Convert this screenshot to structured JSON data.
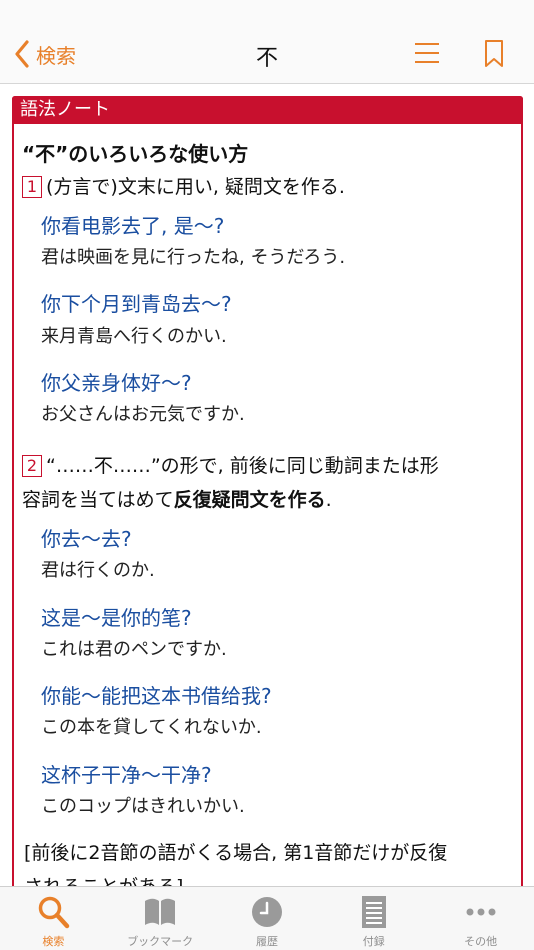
{
  "nav": {
    "back_label": "検索",
    "title": "不"
  },
  "note": {
    "header": "語法ノート",
    "heading": "“不”のいろいろな使い方",
    "section1": {
      "num": "1",
      "text": "(方言で)文末に用い, 疑問文を作る.",
      "examples": [
        {
          "zh": "你看电影去了, 是～?",
          "ja": "君は映画を見に行ったね, そうだろう."
        },
        {
          "zh": "你下个月到青岛去～?",
          "ja": "来月青島へ行くのかい."
        },
        {
          "zh": "你父亲身体好～?",
          "ja": "お父さんはお元気ですか."
        }
      ]
    },
    "section2": {
      "num": "2",
      "text_line1": "“……不……”の形で, 前後に同じ動詞または形",
      "text_line2_a": "容詞を当てはめて",
      "text_line2_b": "反復疑問文を作る",
      "text_line2_c": ".",
      "examples": [
        {
          "zh": "你去～去?",
          "ja": "君は行くのか."
        },
        {
          "zh": "这是～是你的笔?",
          "ja": "これは君のペンですか."
        },
        {
          "zh": "你能～能把这本书借给我?",
          "ja": "この本を貸してくれないか."
        },
        {
          "zh": "这杯子干净～干净?",
          "ja": "このコップはきれいかい."
        }
      ]
    },
    "footnote_line1": "[前後に2音節の語がくる場合, 第1音節だけが反復",
    "footnote_line2": "されることがある]"
  },
  "tabs": [
    {
      "label": "検索",
      "icon": "search-icon",
      "active": true
    },
    {
      "label": "ブックマーク",
      "icon": "book-icon",
      "active": false
    },
    {
      "label": "履歴",
      "icon": "clock-icon",
      "active": false
    },
    {
      "label": "付録",
      "icon": "document-icon",
      "active": false
    },
    {
      "label": "その他",
      "icon": "more-icon",
      "active": false
    }
  ],
  "colors": {
    "accent": "#e8802a",
    "note_red": "#c8102e",
    "example_blue": "#1a4ea0"
  }
}
